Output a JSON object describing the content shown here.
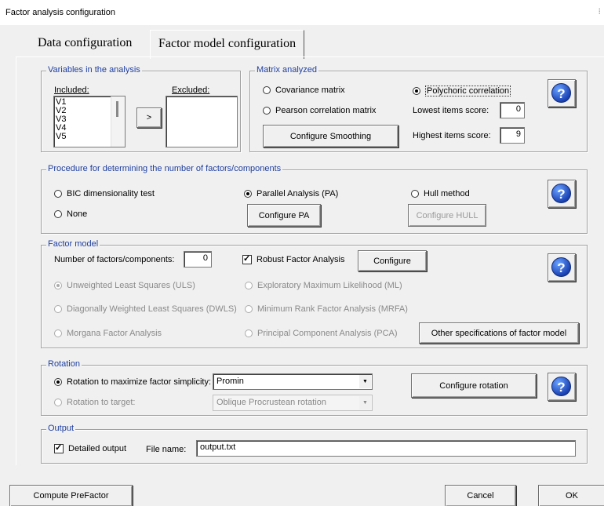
{
  "window": {
    "title": "Factor analysis configuration"
  },
  "tabs": [
    {
      "label": "Data configuration",
      "active": false
    },
    {
      "label": "Factor model configuration",
      "active": true
    }
  ],
  "variables": {
    "legend": "Variables in the analysis",
    "included_label": "Included:",
    "excluded_label": "Excluded:",
    "included_items": [
      "V1",
      "V2",
      "V3",
      "V4",
      "V5"
    ],
    "move_button": ">"
  },
  "matrix": {
    "legend": "Matrix analyzed",
    "covariance": "Covariance matrix",
    "pearson": "Pearson correlation matrix",
    "polychoric": "Polychoric correlation",
    "lowest_label": "Lowest items score:",
    "lowest_value": "0",
    "highest_label": "Highest items score:",
    "highest_value": "9",
    "smoothing_button": "Configure Smoothing"
  },
  "procedure": {
    "legend": "Procedure for determining the number of factors/components",
    "bic": "BIC dimensionality test",
    "none": "None",
    "pa": "Parallel Analysis (PA)",
    "hull": "Hull method",
    "configure_pa": "Configure PA",
    "configure_hull": "Configure HULL"
  },
  "factor_model": {
    "legend": "Factor model",
    "num_label": "Number of factors/components:",
    "num_value": "0",
    "robust_label": "Robust Factor Analysis",
    "configure_button": "Configure",
    "uls": "Unweighted Least Squares (ULS)",
    "dwls": "Diagonally Weighted Least Squares (DWLS)",
    "morgana": "Morgana Factor Analysis",
    "ml": "Exploratory Maximum Likelihood (ML)",
    "mrfa": "Minimum Rank Factor Analysis (MRFA)",
    "pca": "Principal Component Analysis (PCA)",
    "other_button": "Other specifications of factor model"
  },
  "rotation": {
    "legend": "Rotation",
    "maximize_label": "Rotation to maximize factor simplicity:",
    "maximize_value": "Promin",
    "target_label": "Rotation to target:",
    "target_value": "Oblique Procrustean rotation",
    "configure_button": "Configure rotation"
  },
  "output": {
    "legend": "Output",
    "detailed_label": "Detailed output",
    "file_label": "File name:",
    "file_value": "output.txt"
  },
  "footer": {
    "compute": "Compute PreFactor",
    "cancel": "Cancel",
    "ok": "OK"
  },
  "icons": {
    "help": "help-icon",
    "question_glyph": "?"
  }
}
